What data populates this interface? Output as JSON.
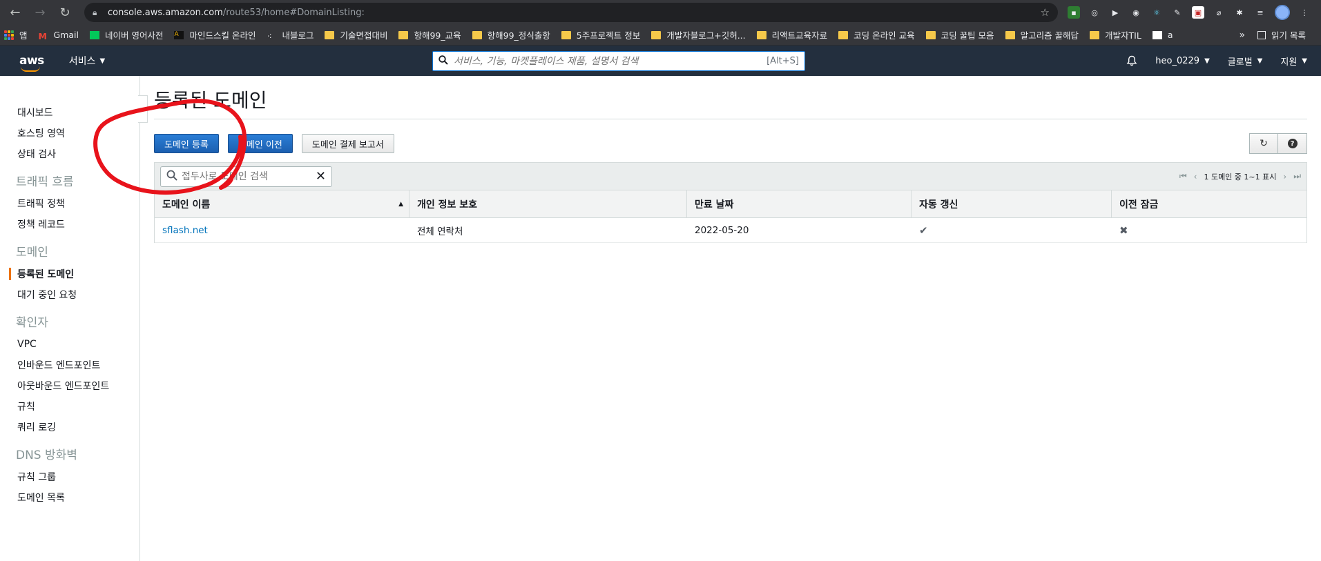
{
  "browser": {
    "url_host": "console.aws.amazon.com",
    "url_path": "/route53/home#DomainListing:",
    "bookmarks": [
      {
        "label": "앱",
        "type": "apps"
      },
      {
        "label": "Gmail",
        "type": "gmail"
      },
      {
        "label": "네이버 영어사전",
        "type": "naver"
      },
      {
        "label": "마인드스킬 온라인",
        "type": "a"
      },
      {
        "label": "내블로그",
        "type": "t"
      },
      {
        "label": "기술면접대비",
        "type": "folder"
      },
      {
        "label": "항해99_교육",
        "type": "folder"
      },
      {
        "label": "항해99_정식출항",
        "type": "folder"
      },
      {
        "label": "5주프로젝트 정보",
        "type": "folder"
      },
      {
        "label": "개발자블로그+깃허...",
        "type": "folder"
      },
      {
        "label": "리액트교육자료",
        "type": "folder"
      },
      {
        "label": "코딩 온라인 교육",
        "type": "folder"
      },
      {
        "label": "코딩 꿀팁 모음",
        "type": "folder"
      },
      {
        "label": "알고리즘 꿀해답",
        "type": "folder"
      },
      {
        "label": "개발자TIL",
        "type": "folder"
      },
      {
        "label": "a",
        "type": "site"
      }
    ],
    "more": "»",
    "reading_list": "읽기 목록"
  },
  "awsnav": {
    "logo": "aws",
    "services": "서비스",
    "search_placeholder": "서비스, 기능, 마켓플레이스 제품, 설명서 검색",
    "search_shortcut": "[Alt+S]",
    "user": "heo_0229",
    "region": "글로벌",
    "support": "지원"
  },
  "sidebar": {
    "items_top": [
      "대시보드",
      "호스팅 영역",
      "상태 검사"
    ],
    "section_traffic": "트래픽 흐름",
    "items_traffic": [
      "트래픽 정책",
      "정책 레코드"
    ],
    "section_domain": "도메인",
    "items_domain": [
      "등록된 도메인",
      "대기 중인 요청"
    ],
    "section_resolver": "확인자",
    "items_resolver": [
      "VPC",
      "인바운드 엔드포인트",
      "아웃바운드 엔드포인트",
      "규칙",
      "쿼리 로깅"
    ],
    "section_dns": "DNS 방화벽",
    "items_dns": [
      "규칙 그룹",
      "도메인 목록"
    ]
  },
  "main": {
    "title": "등록된 도메인",
    "btn_register": "도메인 등록",
    "btn_transfer": "도메인 이전",
    "btn_billing": "도메인 결제 보고서",
    "filter_placeholder": "접두사로 도메인 검색",
    "pager_text": "1 도메인 중 1~1 표시",
    "columns": [
      "도메인 이름",
      "개인 정보 보호",
      "만료 날짜",
      "자동 갱신",
      "이전 잠금"
    ],
    "rows": [
      {
        "name": "sflash.net",
        "privacy": "전체 연락처",
        "expiry": "2022-05-20",
        "auto_renew": "✔",
        "transfer_lock": "✖"
      }
    ]
  },
  "colors": {
    "aws_nav": "#232f3e",
    "accent_orange": "#ff9900",
    "primary_blue": "#1b5fb0",
    "annotation_red": "#e8131b"
  }
}
